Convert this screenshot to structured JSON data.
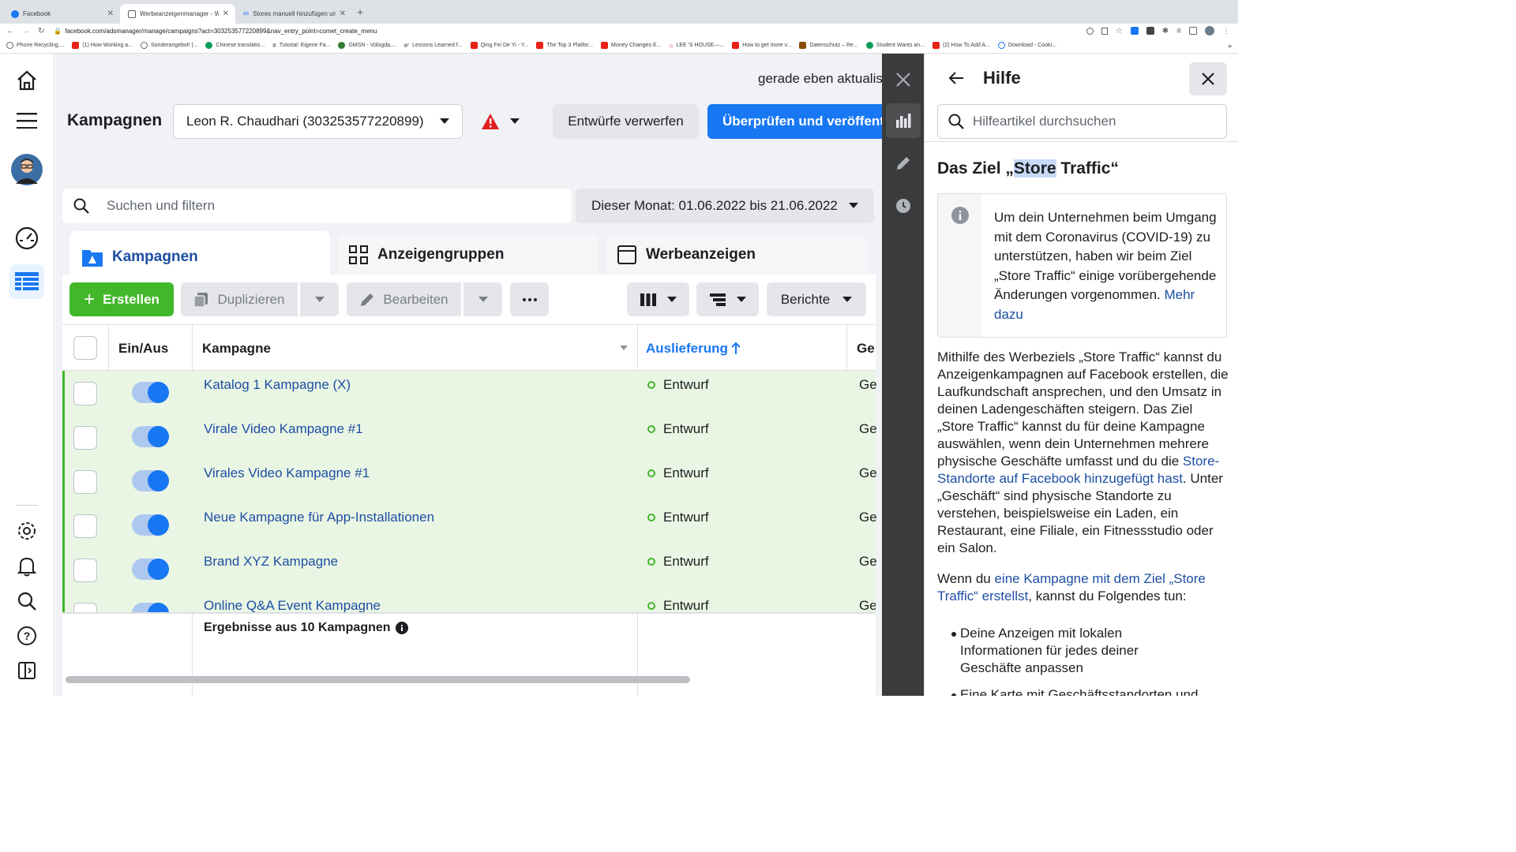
{
  "browser": {
    "tabs": [
      {
        "title": "Facebook",
        "active": false
      },
      {
        "title": "Werbeanzeigenmanager - Wer",
        "active": true
      },
      {
        "title": "Stores manuell hinzufügen un",
        "active": false
      }
    ],
    "url": "facebook.com/adsmanager/manage/campaigns?act=303253577220899&nav_entry_point=comet_create_menu",
    "bookmarks": [
      "Phone Recycling,...",
      "(1) How Working a...",
      "Sonderangebot! |...",
      "Chinese translatio...",
      "Tutorial: Eigene Fa...",
      "GMSN - Vologda,...",
      "Lessons Learned f...",
      "Qing Fei De Yi - Y...",
      "The Top 3 Platfor...",
      "Money Changes E...",
      "LEE 'S HOUSE—...",
      "How to get more v...",
      "Datenschutz – Re...",
      "Student Wants an...",
      "(2) How To Add A...",
      "Download - Cooki..."
    ]
  },
  "header": {
    "title": "Kampagnen",
    "account": "Leon R. Chaudhari (303253577220899)",
    "updated": "gerade eben aktualis",
    "discard": "Entwürfe verwerfen",
    "publish": "Überprüfen und veröffentli"
  },
  "search": {
    "placeholder": "Suchen und filtern"
  },
  "daterange": "Dieser Monat: 01.06.2022 bis 21.06.2022",
  "tabs": {
    "campaigns": "Kampagnen",
    "adsets": "Anzeigengruppen",
    "ads": "Werbeanzeigen"
  },
  "toolbar": {
    "create": "Erstellen",
    "duplicate": "Duplizieren",
    "edit": "Bearbeiten",
    "reports": "Berichte"
  },
  "table": {
    "headers": {
      "onoff": "Ein/Aus",
      "campaign": "Kampagne",
      "delivery": "Auslieferung",
      "next": "Ge"
    },
    "rows": [
      {
        "name": "Katalog 1 Kampagne (X)",
        "status": "Entwurf",
        "extra": "Ge"
      },
      {
        "name": "Virale Video Kampagne #1",
        "status": "Entwurf",
        "extra": "Ge"
      },
      {
        "name": "Virales Video Kampagne #1",
        "status": "Entwurf",
        "extra": "Ge"
      },
      {
        "name": "Neue Kampagne für App-Installationen",
        "status": "Entwurf",
        "extra": "Ge"
      },
      {
        "name": "Brand XYZ Kampagne",
        "status": "Entwurf",
        "extra": "Ge"
      },
      {
        "name": "Online Q&A Event Kampagne",
        "status": "Entwurf",
        "extra": "Ge"
      }
    ],
    "summary": "Ergebnisse aus 10 Kampagnen"
  },
  "help": {
    "title": "Hilfe",
    "search_placeholder": "Hilfeartikel durchsuchen",
    "article_title_pre": "Das Ziel „",
    "article_title_hl": "Store",
    "article_title_post": " Traffic“",
    "notice": "Um dein Unternehmen beim Umgang mit dem Coronavirus (COVID-19) zu unterstützen, haben wir beim Ziel „Store Traffic“ einige vorübergehende Änderungen vorgenommen.",
    "notice_link": "Mehr dazu",
    "p1_a": "Mithilfe des Werbeziels „Store Traffic“ kannst du Anzeigenkampagnen auf Facebook erstellen, die Laufkundschaft ansprechen, und den Umsatz in deinen Ladengeschäften steigern. Das Ziel „Store Traffic“ kannst du für deine Kampagne auswählen, wenn dein Unternehmen mehrere physische Geschäfte umfasst und du die ",
    "p1_link": "Store-Standorte auf Facebook hinzugefügt hast",
    "p1_b": ". Unter „Geschäft“ sind physische Standorte zu verstehen, beispielsweise ein Laden, ein Restaurant, eine Filiale, ein Fitnessstudio oder ein Salon.",
    "p2_a": "Wenn du ",
    "p2_link": "eine Kampagne mit dem Ziel „Store Traffic“ erstellst",
    "p2_b": ", kannst du Folgendes tun:",
    "bullet1": "Deine Anzeigen mit lokalen Informationen für jedes deiner Geschäfte anpassen",
    "bullet2": "Eine Karte mit Geschäftsstandorten und"
  },
  "colors": {
    "primary": "#1877f2",
    "green": "#42b72a",
    "rowbg": "#eaf6e4",
    "link": "#1d4ea3",
    "warning": "#e02020"
  }
}
